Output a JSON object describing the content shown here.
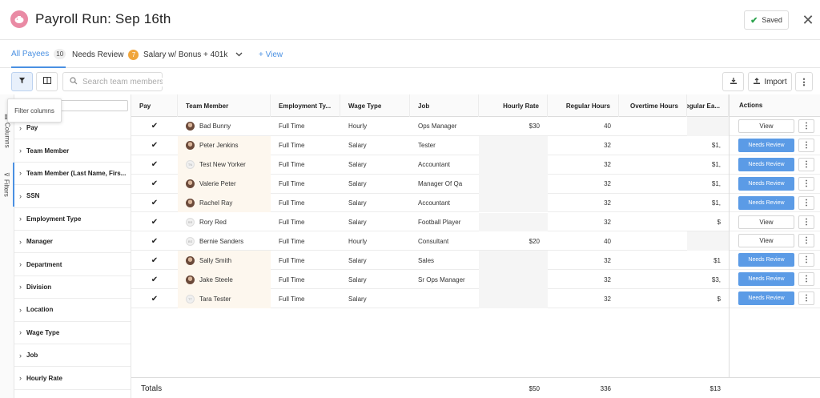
{
  "header": {
    "title": "Payroll Run: Sep 16th",
    "saved_label": "Saved",
    "close_glyph": "✕"
  },
  "tabs": [
    {
      "label": "All Payees",
      "count": "10",
      "active": true
    },
    {
      "label": "Needs Review",
      "count": "7",
      "active": false
    },
    {
      "label": "Salary w/ Bonus + 401k",
      "count": "",
      "active": false
    }
  ],
  "add_view_label": "+ View",
  "toolbar": {
    "search_placeholder": "Search team members...",
    "import_label": "Import"
  },
  "tooltip": "Filter columns",
  "sidetabs": {
    "columns_label": "Columns",
    "filters_label": "Filters"
  },
  "filter_fields": [
    "Pay",
    "Team Member",
    "Team Member (Last Name, Firs...",
    "SSN",
    "Employment Type",
    "Manager",
    "Department",
    "Division",
    "Location",
    "Wage Type",
    "Job",
    "Hourly Rate"
  ],
  "columns": [
    "Pay",
    "Team Member",
    "Employment Ty...",
    "Wage Type",
    "Job",
    "Hourly Rate",
    "Regular Hours",
    "Overtime Hours",
    "Regular Ea...",
    "Actions"
  ],
  "rows": [
    {
      "name": "Bad Bunny",
      "avatar": "photo",
      "initials": "",
      "employment": "Full Time",
      "wage": "Hourly",
      "job": "Ops Manager",
      "rate": "$30",
      "hours": "40",
      "overtime": "",
      "earnings": "",
      "action": "View"
    },
    {
      "name": "Peter Jenkins",
      "avatar": "photo",
      "initials": "",
      "employment": "Full Time",
      "wage": "Salary",
      "job": "Tester",
      "rate": "",
      "hours": "32",
      "overtime": "",
      "earnings": "$1,",
      "action": "Needs Review"
    },
    {
      "name": "Test New Yorker",
      "avatar": "init",
      "initials": "TN",
      "employment": "Full Time",
      "wage": "Salary",
      "job": "Accountant",
      "rate": "",
      "hours": "32",
      "overtime": "",
      "earnings": "$1,",
      "action": "Needs Review"
    },
    {
      "name": "Valerie Peter",
      "avatar": "photo",
      "initials": "",
      "employment": "Full Time",
      "wage": "Salary",
      "job": "Manager Of Qa",
      "rate": "",
      "hours": "32",
      "overtime": "",
      "earnings": "$1,",
      "action": "Needs Review"
    },
    {
      "name": "Rachel Ray",
      "avatar": "photo",
      "initials": "",
      "employment": "Full Time",
      "wage": "Salary",
      "job": "Accountant",
      "rate": "",
      "hours": "32",
      "overtime": "",
      "earnings": "$1,",
      "action": "Needs Review"
    },
    {
      "name": "Rory Red",
      "avatar": "init",
      "initials": "RR",
      "employment": "Full Time",
      "wage": "Salary",
      "job": "Football Player",
      "rate": "",
      "hours": "32",
      "overtime": "",
      "earnings": "$",
      "action": "View"
    },
    {
      "name": "Bernie Sanders",
      "avatar": "init",
      "initials": "BS",
      "employment": "Full Time",
      "wage": "Hourly",
      "job": "Consultant",
      "rate": "$20",
      "hours": "40",
      "overtime": "",
      "earnings": "",
      "action": "View"
    },
    {
      "name": "Sally Smith",
      "avatar": "photo",
      "initials": "",
      "employment": "Full Time",
      "wage": "Salary",
      "job": "Sales",
      "rate": "",
      "hours": "32",
      "overtime": "",
      "earnings": "$1",
      "action": "Needs Review"
    },
    {
      "name": "Jake Steele",
      "avatar": "photo",
      "initials": "",
      "employment": "Full Time",
      "wage": "Salary",
      "job": "Sr Ops Manager",
      "rate": "",
      "hours": "32",
      "overtime": "",
      "earnings": "$3,",
      "action": "Needs Review"
    },
    {
      "name": "Tara Tester",
      "avatar": "init",
      "initials": "TT",
      "employment": "Full Time",
      "wage": "Salary",
      "job": "",
      "rate": "",
      "hours": "32",
      "overtime": "",
      "earnings": "$",
      "action": "Needs Review"
    }
  ],
  "totals": {
    "label": "Totals",
    "rate": "$50",
    "hours": "336",
    "earnings": "$13"
  },
  "colors": {
    "accent": "#4a90e2",
    "review_button": "#5b9be6",
    "badge_orange": "#f0a53b",
    "saved_check": "#2ea44f",
    "logo": "#e98aa4"
  },
  "icons": {
    "logo": "piggy-bank-icon",
    "saved": "check-icon",
    "filter": "filter-icon",
    "columns": "columns-icon",
    "search": "search-icon",
    "download": "download-icon",
    "upload": "upload-icon",
    "more": "kebab-icon"
  }
}
